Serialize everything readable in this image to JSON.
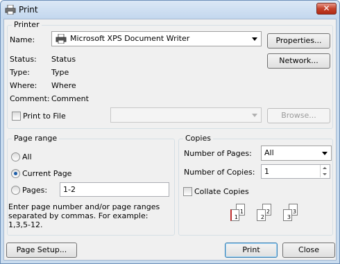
{
  "window": {
    "title": "Print",
    "close_label": "✕"
  },
  "printer": {
    "legend": "Printer",
    "name_label": "Name:",
    "name_value": "Microsoft XPS Document Writer",
    "status_label": "Status:",
    "status_value": "Status",
    "type_label": "Type:",
    "type_value": "Type",
    "where_label": "Where:",
    "where_value": "Where",
    "comment_label": "Comment:",
    "comment_value": "Comment",
    "print_to_file": "Print to File",
    "properties_button": "Properties...",
    "network_button": "Network...",
    "browse_button": "Browse..."
  },
  "page_range": {
    "legend": "Page range",
    "all": "All",
    "current_page": "Current Page",
    "pages": "Pages:",
    "pages_value": "1-2",
    "selected": "current_page",
    "hint": "Enter page number and/or page ranges separated by commas. For example: 1,3,5-12."
  },
  "copies": {
    "legend": "Copies",
    "number_of_pages_label": "Number of Pages:",
    "number_of_pages_value": "All",
    "number_of_copies_label": "Number of Copies:",
    "number_of_copies_value": "1",
    "collate_label": "Collate Copies",
    "collate_checked": false,
    "collate_pages": [
      "1",
      "1",
      "2",
      "2",
      "3",
      "3"
    ]
  },
  "footer": {
    "page_setup_button": "Page Setup...",
    "print_button": "Print",
    "close_button": "Close"
  },
  "colors": {
    "accent": "#1e5ea8",
    "titlebar": "#c9dcef",
    "close": "#c4412a"
  }
}
